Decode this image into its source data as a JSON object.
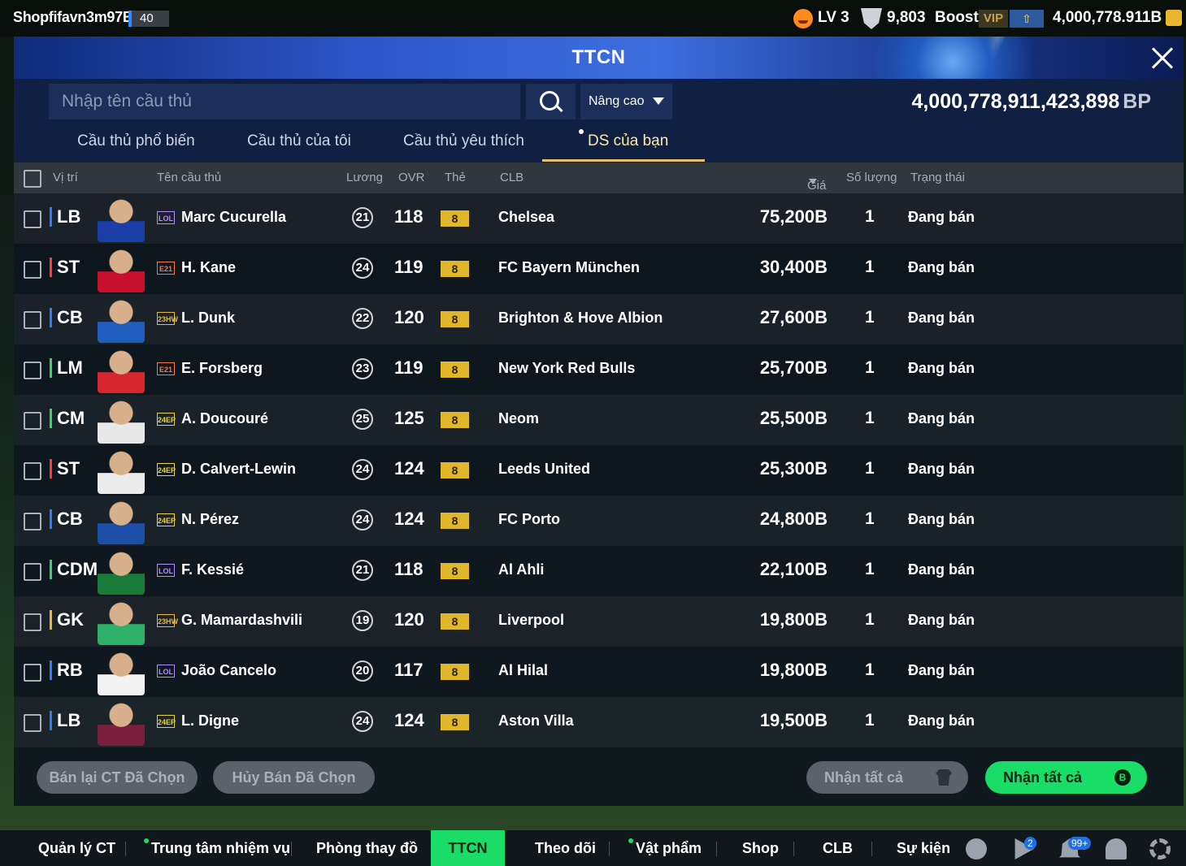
{
  "topbar": {
    "username": "Shopfifavn3m97B",
    "user_level": "40",
    "level_text": "LV 3",
    "points": "9,803",
    "boost": "Boost",
    "vip": "VIP",
    "balance": "4,000,778.911B"
  },
  "window": {
    "title": "TTCN",
    "bp_total": "4,000,778,911,423,898",
    "bp_unit": "BP"
  },
  "search": {
    "placeholder": "Nhập tên cầu thủ",
    "advanced_label": "Nâng cao"
  },
  "tabs": [
    {
      "label": "Cầu thủ phổ biến",
      "active": false
    },
    {
      "label": "Cầu thủ của tôi",
      "active": false
    },
    {
      "label": "Cầu thủ yêu thích",
      "active": false
    },
    {
      "label": "DS của bạn",
      "active": true
    }
  ],
  "columns": {
    "position": "Vị trí",
    "name": "Tên cầu thủ",
    "wage": "Lương",
    "ovr": "OVR",
    "card": "Thẻ",
    "club": "CLB",
    "price": "Giá",
    "qty": "Số lượng",
    "status": "Trạng thái"
  },
  "players": [
    {
      "pos": "LB",
      "pos_color": "#2f7cff",
      "season": "LOL",
      "season_color": "#b58cff",
      "name": "Marc Cucurella",
      "wage": "21",
      "ovr": "118",
      "card": "8",
      "club": "Chelsea",
      "price": "75,200B",
      "qty": "1",
      "status": "Đang bán",
      "kit": "#1b3ea8"
    },
    {
      "pos": "ST",
      "pos_color": "#ff3a3a",
      "season": "E21",
      "season_color": "#ff7a3a",
      "name": "H. Kane",
      "wage": "24",
      "ovr": "119",
      "card": "8",
      "club": "FC Bayern München",
      "price": "30,400B",
      "qty": "1",
      "status": "Đang bán",
      "kit": "#c8102e"
    },
    {
      "pos": "CB",
      "pos_color": "#2f7cff",
      "season": "23HW",
      "season_color": "#e8b93a",
      "name": "L. Dunk",
      "wage": "22",
      "ovr": "120",
      "card": "8",
      "club": "Brighton & Hove Albion",
      "price": "27,600B",
      "qty": "1",
      "status": "Đang bán",
      "kit": "#1f5dbf"
    },
    {
      "pos": "LM",
      "pos_color": "#3ad36a",
      "season": "E21",
      "season_color": "#ff7a3a",
      "name": "E. Forsberg",
      "wage": "23",
      "ovr": "119",
      "card": "8",
      "club": "New York Red Bulls",
      "price": "25,700B",
      "qty": "1",
      "status": "Đang bán",
      "kit": "#d8262f"
    },
    {
      "pos": "CM",
      "pos_color": "#3ad36a",
      "season": "24EP",
      "season_color": "#e8d33a",
      "name": "A. Doucouré",
      "wage": "25",
      "ovr": "125",
      "card": "8",
      "club": "Neom",
      "price": "25,500B",
      "qty": "1",
      "status": "Đang bán",
      "kit": "#e8e8e8"
    },
    {
      "pos": "ST",
      "pos_color": "#ff3a3a",
      "season": "24EP",
      "season_color": "#e8d33a",
      "name": "D. Calvert-Lewin",
      "wage": "24",
      "ovr": "124",
      "card": "8",
      "club": "Leeds United",
      "price": "25,300B",
      "qty": "1",
      "status": "Đang bán",
      "kit": "#ececec"
    },
    {
      "pos": "CB",
      "pos_color": "#2f7cff",
      "season": "24EP",
      "season_color": "#e8d33a",
      "name": "N. Pérez",
      "wage": "24",
      "ovr": "124",
      "card": "8",
      "club": "FC Porto",
      "price": "24,800B",
      "qty": "1",
      "status": "Đang bán",
      "kit": "#1d4fa8"
    },
    {
      "pos": "CDM",
      "pos_color": "#3ad36a",
      "season": "LOL",
      "season_color": "#b58cff",
      "name": "F. Kessié",
      "wage": "21",
      "ovr": "118",
      "card": "8",
      "club": "Al Ahli",
      "price": "22,100B",
      "qty": "1",
      "status": "Đang bán",
      "kit": "#1a7a3a"
    },
    {
      "pos": "GK",
      "pos_color": "#e8b93a",
      "season": "23HW",
      "season_color": "#e8b93a",
      "name": "G. Mamardashvili",
      "wage": "19",
      "ovr": "120",
      "card": "8",
      "club": "Liverpool",
      "price": "19,800B",
      "qty": "1",
      "status": "Đang bán",
      "kit": "#2fb06a"
    },
    {
      "pos": "RB",
      "pos_color": "#2f7cff",
      "season": "LOL",
      "season_color": "#b58cff",
      "name": "João Cancelo",
      "wage": "20",
      "ovr": "117",
      "card": "8",
      "club": "Al Hilal",
      "price": "19,800B",
      "qty": "1",
      "status": "Đang bán",
      "kit": "#f2f2f2"
    },
    {
      "pos": "LB",
      "pos_color": "#2f7cff",
      "season": "24EP",
      "season_color": "#e8d33a",
      "name": "L. Digne",
      "wage": "24",
      "ovr": "124",
      "card": "8",
      "club": "Aston Villa",
      "price": "19,500B",
      "qty": "1",
      "status": "Đang bán",
      "kit": "#7a1f3d"
    }
  ],
  "actions": {
    "resell": "Bán lại CT Đã Chọn",
    "cancel_sale": "Hủy Bán Đã Chọn",
    "claim_all_gray": "Nhận tất cả",
    "claim_all_green": "Nhận tất cả",
    "b_badge": "B"
  },
  "bottom_nav": {
    "items": [
      {
        "label": "Quản lý CT"
      },
      {
        "label": "Trung tâm nhiệm vụ"
      },
      {
        "label": "Phòng thay đồ"
      },
      {
        "label": "TTCN"
      },
      {
        "label": "Theo dõi"
      },
      {
        "label": "Vật phẩm"
      },
      {
        "label": "Shop"
      },
      {
        "label": "CLB"
      },
      {
        "label": "Sự kiện"
      }
    ],
    "play_badge": "2",
    "notif_badge": "99+"
  },
  "icons": [
    "face-icon",
    "shield-icon",
    "up-arrow-icon",
    "coin-icon",
    "close-icon",
    "search-icon",
    "chevron-down-icon",
    "shirt-icon",
    "chat-icon",
    "play-icon",
    "bell-icon",
    "user-icon",
    "gear-icon"
  ],
  "colors": {
    "accent_green": "#19dd67",
    "gold": "#e0b72b",
    "title_blue": "#2d56c9"
  }
}
